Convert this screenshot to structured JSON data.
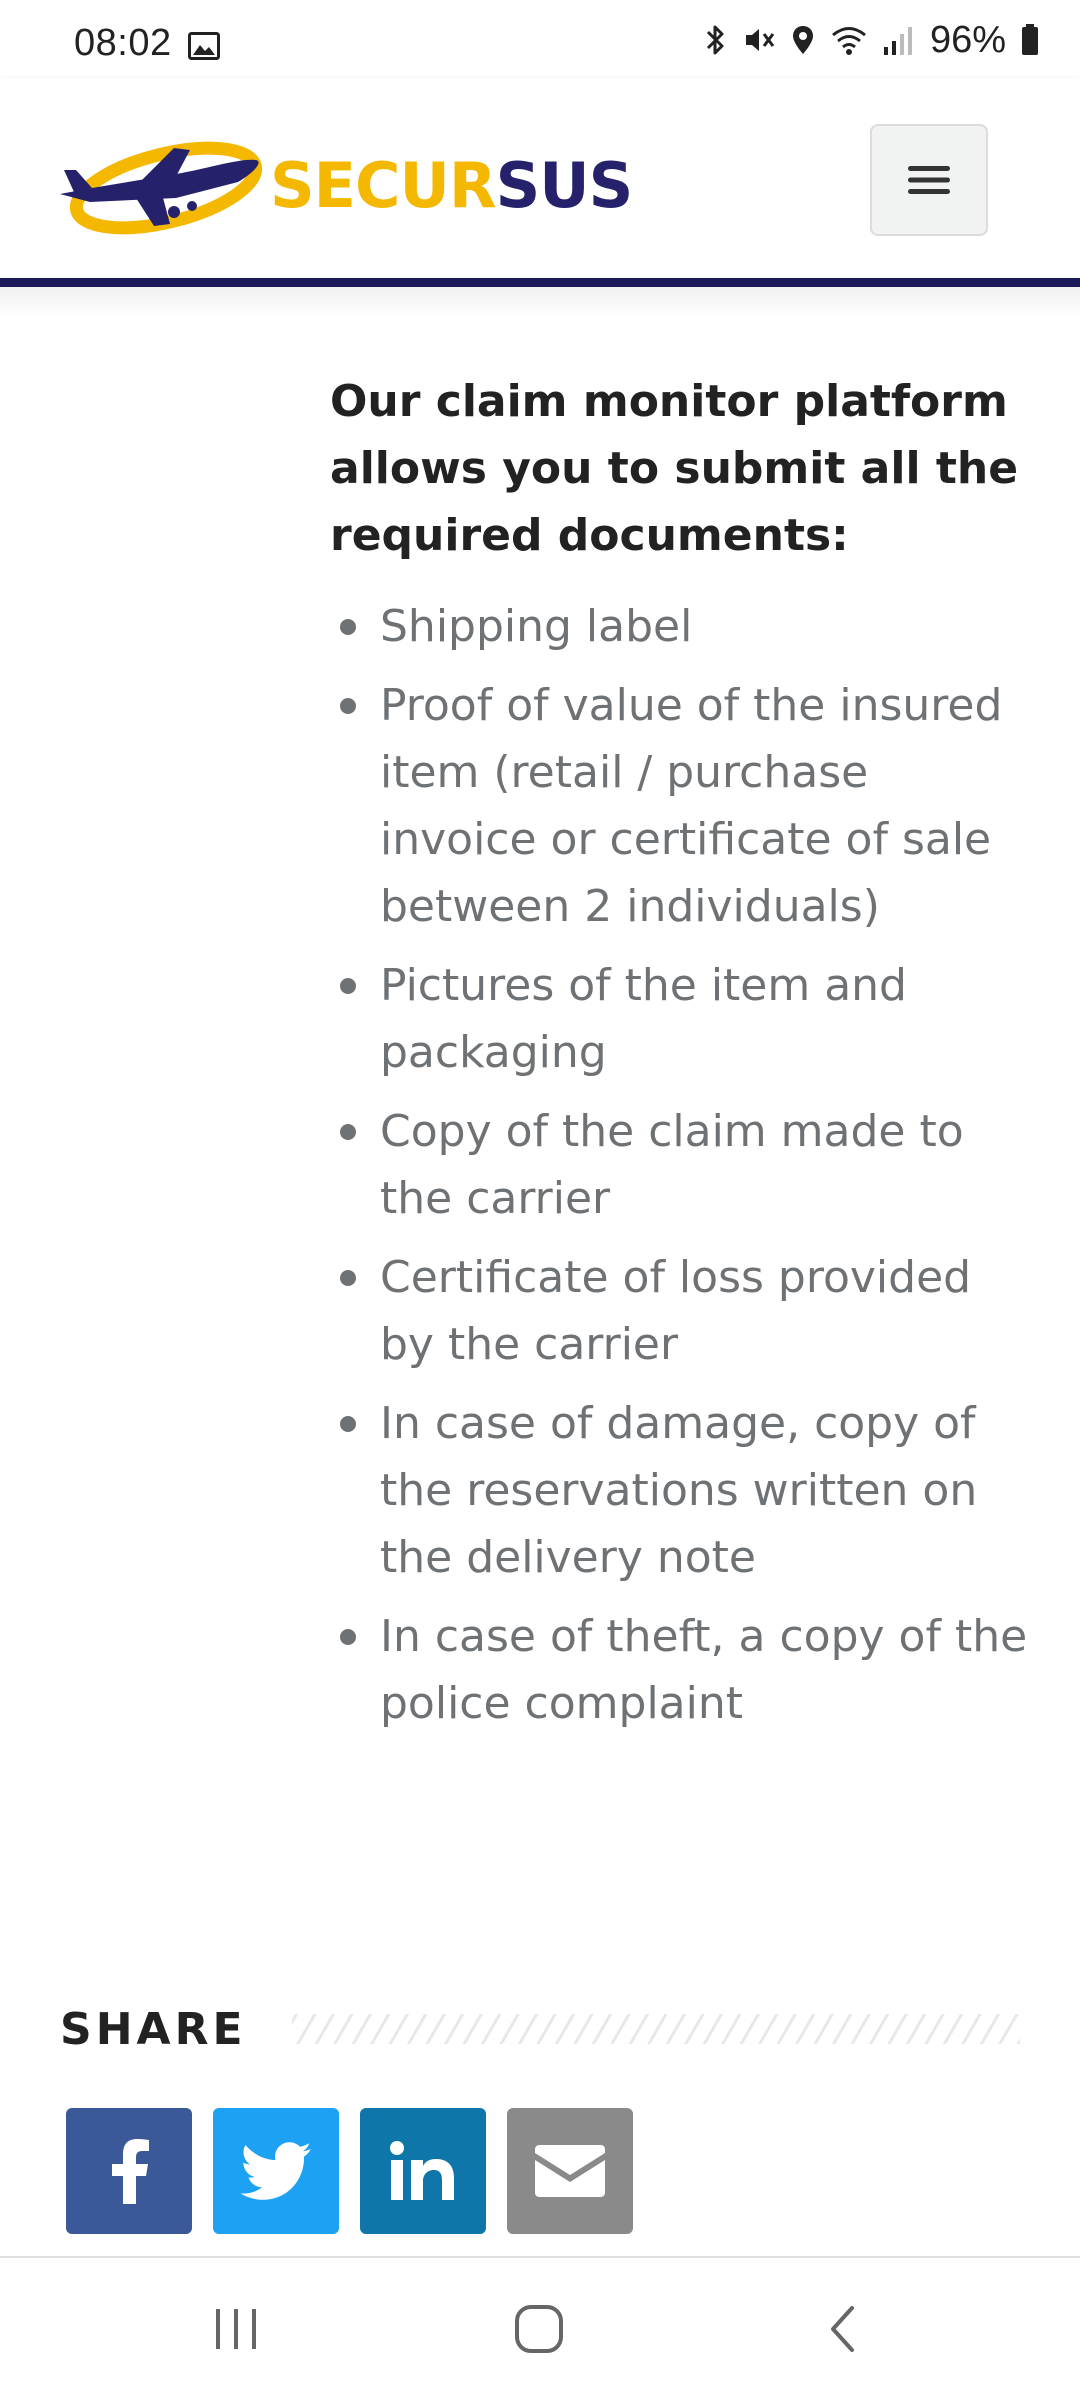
{
  "status_bar": {
    "time": "08:02",
    "battery": "96%",
    "icons": [
      "gallery-icon",
      "bluetooth-icon",
      "mute-vibrate-icon",
      "location-icon",
      "wifi-icon",
      "signal-icon",
      "battery-icon"
    ]
  },
  "header": {
    "logo_text_a": "SECUR",
    "logo_text_b": "SUS",
    "menu_icon": "hamburger-icon",
    "colors": {
      "logo_yellow": "#f5b800",
      "logo_navy": "#26216b",
      "rule": "#1c1a5a"
    }
  },
  "content": {
    "heading": "Our claim monitor platform allows you to submit all the required documents:",
    "items": [
      "Shipping label",
      "Proof of value of the insured item (retail / purchase invoice or certificate of sale between 2 individuals)",
      "Pictures of the item and packaging",
      "Copy of the claim made to the carrier",
      "Certificate of loss provided by the carrier",
      "In case of damage, copy of the reservations written on the delivery note",
      "In case of theft, a copy of the police complaint"
    ]
  },
  "share": {
    "heading": "SHARE",
    "buttons": [
      {
        "name": "facebook",
        "icon": "facebook-icon",
        "color": "#3b5998"
      },
      {
        "name": "twitter",
        "icon": "twitter-icon",
        "color": "#1da1f2"
      },
      {
        "name": "linkedin",
        "icon": "linkedin-icon",
        "color": "#0e76a8"
      },
      {
        "name": "email",
        "icon": "envelope-icon",
        "color": "#8a8a8a"
      }
    ]
  },
  "nav_bar": {
    "buttons": [
      "recent-apps-icon",
      "home-icon",
      "back-icon"
    ]
  }
}
